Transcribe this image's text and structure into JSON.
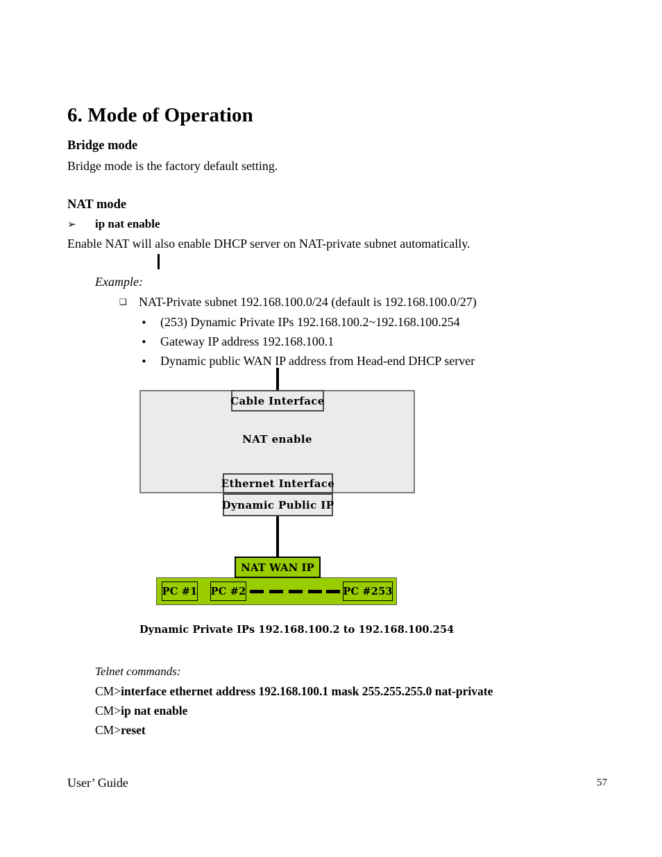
{
  "document": {
    "heading": "6. Mode of Operation",
    "sections": [
      {
        "title": "Bridge mode",
        "body": "Bridge mode is the factory default setting."
      },
      {
        "title": "NAT mode",
        "arrow_item": "ip nat enable",
        "body": "Enable NAT will also enable DHCP server on NAT-private subnet automatically."
      }
    ],
    "example": {
      "label": "Example:",
      "square_item": "NAT-Private subnet 192.168.100.0/24 (default is 192.168.100.0/27)",
      "bullets": [
        "(253) Dynamic Private IPs 192.168.100.2~192.168.100.254",
        "Gateway IP address 192.168.100.1",
        "Dynamic public WAN IP address from Head-end DHCP server"
      ]
    },
    "diagram": {
      "cable_interface": "Cable Interface",
      "nat_enable": "NAT enable",
      "ethernet_interface": "Ethernet  Interface",
      "dynamic_public_ip": "Dynamic Public  IP",
      "nat_wan_ip": "NAT WAN IP",
      "pc_first": "PC #1",
      "pc_second": "PC #2",
      "pc_last": "PC #253",
      "caption": "Dynamic Private IPs 192.168.100.2 to  192.168.100.254",
      "accent_green": "#9ACD00",
      "panel_gray": "#EBEBEB",
      "panel_border": "#7B7B7B"
    },
    "telnet": {
      "label": "Telnet commands:",
      "commands": [
        {
          "prompt": "CM>",
          "body": "interface ethernet address 192.168.100.1 mask 255.255.255.0 nat-private"
        },
        {
          "prompt": "CM>",
          "body": "ip nat enable"
        },
        {
          "prompt": "CM>",
          "body": "reset"
        }
      ]
    },
    "footer": {
      "left": "User’ Guide",
      "page_number": "57"
    },
    "glyphs": {
      "arrow": "➢",
      "square": "❏",
      "dot": "•"
    }
  }
}
